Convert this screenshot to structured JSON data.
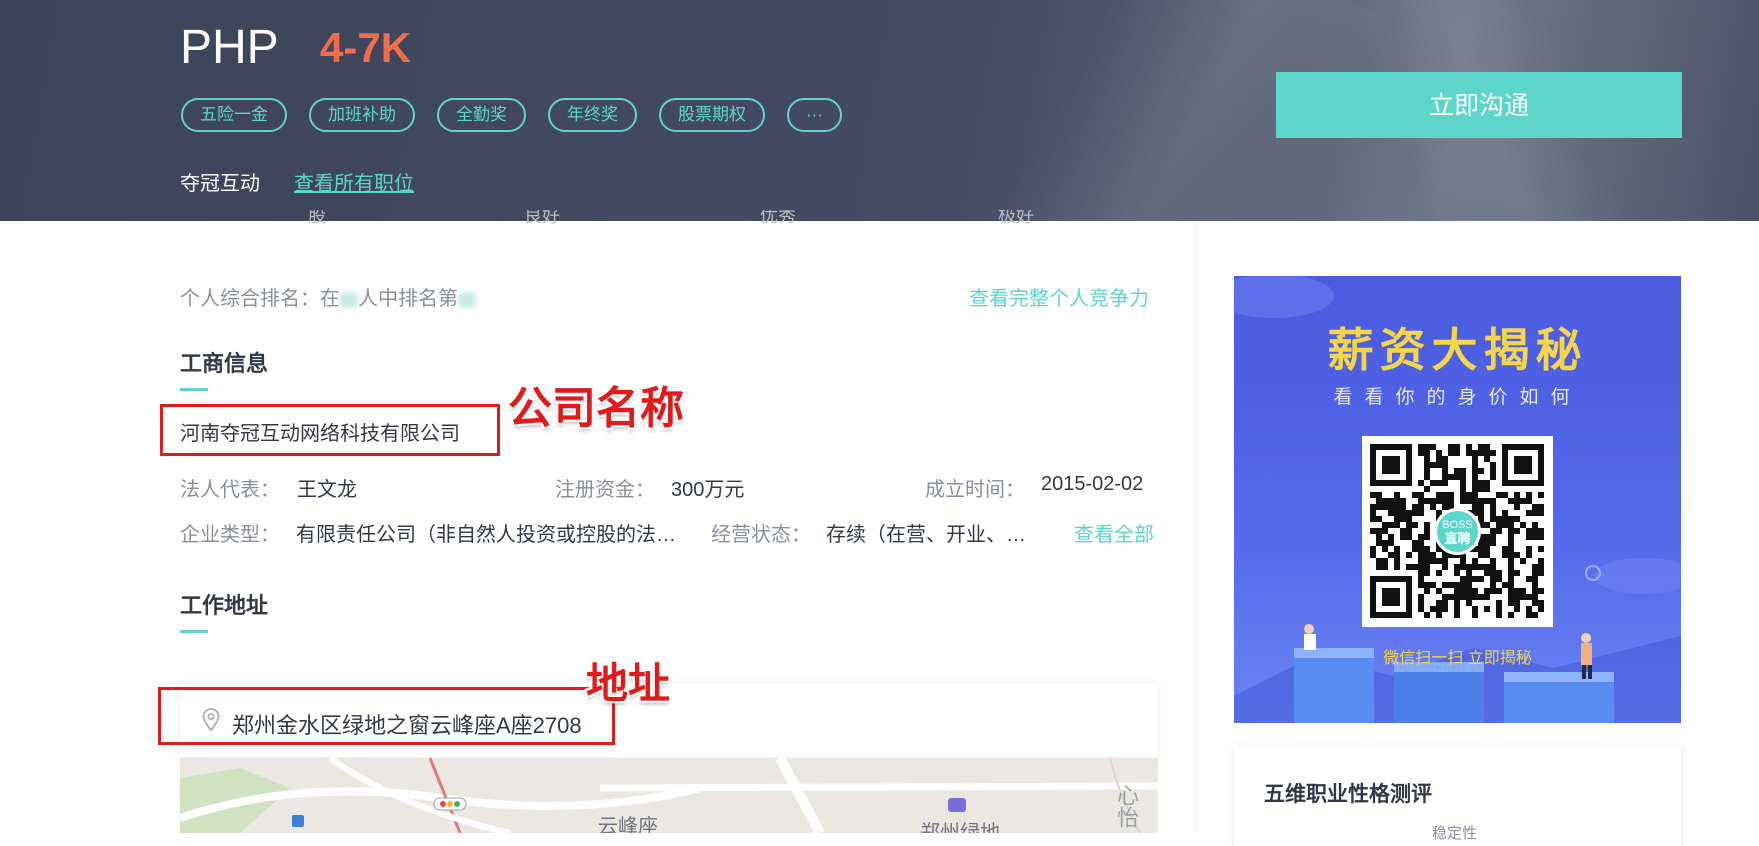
{
  "job": {
    "title": "PHP",
    "salary": "4-7K",
    "tags": [
      "五险一金",
      "加班补助",
      "全勤奖",
      "年终奖",
      "股票期权",
      "···"
    ],
    "company_short": "夺冠互动",
    "view_all_jobs_link": "查看所有职位",
    "chat_button": "立即沟通"
  },
  "competitiveness": {
    "rank_prefix": "个人综合排名：在",
    "rank_middle": "人中排名第",
    "link": "查看完整个人竞争力",
    "faded_labels": [
      "股",
      "良好",
      "优秀",
      "极好"
    ]
  },
  "business_info": {
    "section_title": "工商信息",
    "company_full_name": "河南夺冠互动网络科技有限公司",
    "annotation": "公司名称",
    "legal_rep_label": "法人代表：",
    "legal_rep": "王文龙",
    "capital_label": "注册资金：",
    "capital": "300万元",
    "founded_label": "成立时间：",
    "founded": "2015-02-02",
    "type_label": "企业类型：",
    "type": "有限责任公司（非自然人投资或控股的法…",
    "status_label": "经营状态：",
    "status": "存续（在营、开业、…",
    "view_all": "查看全部"
  },
  "work_address": {
    "section_title": "工作地址",
    "annotation": "地址",
    "address": "郑州金水区绿地之窗云峰座A座2708",
    "map_labels": [
      "云峰座",
      "郑州绿地",
      "心怡"
    ]
  },
  "sidebar": {
    "promo_title": "薪资大揭秘",
    "promo_subtitle": "看看你的身价如何",
    "qr_badge_line1": "BOSS",
    "qr_badge_line2": "直聘",
    "promo_cta": "微信扫一扫  立即揭秘",
    "test_title": "五维职业性格测评",
    "test_sub": "稳定性"
  },
  "colors": {
    "accent": "#5dd5c8",
    "salary": "#f26d4b",
    "banner": "#444c63",
    "annotation_red": "#e01b1b",
    "promo_yellow": "#f5d54a",
    "promo_blue": "#5066e6"
  }
}
